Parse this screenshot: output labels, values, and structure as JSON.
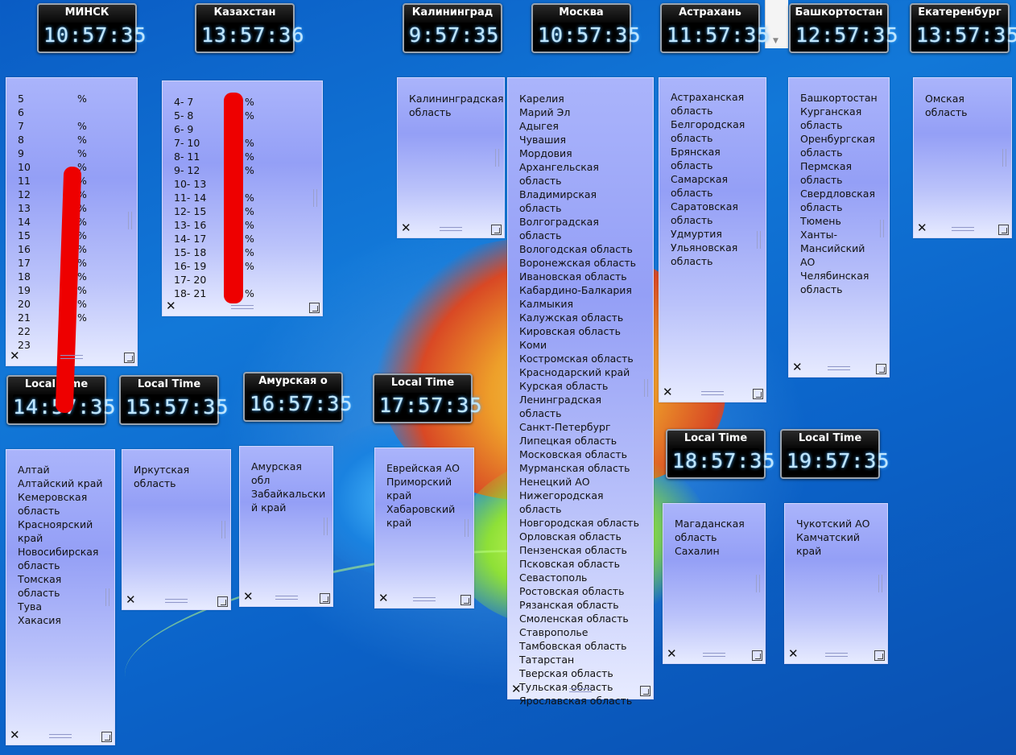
{
  "clocks": [
    {
      "title": "МИНСК",
      "time": "10:57:35"
    },
    {
      "title": "Казахстан",
      "time": "13:57:36"
    },
    {
      "title": "Калининград",
      "time": "9:57:35"
    },
    {
      "title": "Москва",
      "time": "10:57:35"
    },
    {
      "title": "Астрахань",
      "time": "11:57:35"
    },
    {
      "title": "Башкортостан",
      "time": "12:57:35"
    },
    {
      "title": "Екатеренбург",
      "time": "13:57:35"
    },
    {
      "title": "Local Time",
      "time": "14:57:35"
    },
    {
      "title": "Local Time",
      "time": "15:57:35"
    },
    {
      "title": "Амурская о",
      "time": "16:57:35"
    },
    {
      "title": "Local Time",
      "time": "17:57:35"
    },
    {
      "title": "Local Time",
      "time": "18:57:35"
    },
    {
      "title": "Local Time",
      "time": "19:57:35"
    }
  ],
  "notes": {
    "minsk_hours": "5\n6\n7\n8\n9\n10\n11\n12\n13\n14\n15\n16\n17\n18\n19\n20\n21\n22\n23",
    "minsk_pct": "%\n\n%\n%\n%\n%\n%\n%\n%\n%\n%\n%\n%\n%\n%\n%\n%",
    "kz_hours": "4- 7\n5- 8\n6- 9\n7- 10\n8- 11\n9- 12\n10- 13\n11- 14\n12- 15\n13- 16\n14- 17\n15- 18\n16- 19\n17- 20\n18- 21",
    "kz_pct": "%\n%\n\n%\n%\n%\n\n%\n%\n%\n%\n%\n%\n\n%",
    "kaliningrad": "Калининградская\n область",
    "moscow": "Карелия\nМарий Эл\nАдыгея\nЧувашия\nМордовия\nАрхангельская область\nВладимирская область\nВолгоградская область\nВологодская область\nВоронежская область\nИвановская область\nКабардино-Балкария\nКалмыкия\nКалужская область\nКировская область\nКоми\nКостромская область\nКраснодарский край\nКурская область\nЛенинградская область\nСанкт-Петербург\nЛипецкая область\nМосковская область\nМурманская область\nНенецкий АО\nНижегородская область\nНовгородская область\nОрловская область\nПензенская область\nПсковская область\nСевастополь\nРостовская область\nРязанская область\nСмоленская область\nСтаврополье\nТамбовская область\nТатарстан\nТверская область\nТульская область\nЯрославская область",
    "astrakhan": "Астраханская\nобласть\nБелгородская\nобласть\nБрянская\nобласть\nСамарская\nобласть\nСаратовская\nобласть\nУдмуртия\nУльяновская\nобласть",
    "bashkortostan": "Башкортостан\nКурганская\nобласть\nОренбургская\nобласть\nПермская\nобласть\nСвердловская\nобласть\nТюмень\nХанты-\nМансийский\nАО\nЧелябинская\nобласть",
    "omsk": "Омская\nобласть",
    "altai": "Алтай\nАлтайский край\nКемеровская\nобласть\nКрасноярский\nкрай\nНовосибирская\nобласть\nТомская область\nТува\nХакасия",
    "irkutsk": "Иркутская\nобласть",
    "amur": "Амурская обл\nЗабайкальски\nй край",
    "jewish": "Еврейская АО\nПриморский\nкрай\nХабаровский\nкрай",
    "magadan": "Магаданская\nобласть\nСахалин",
    "chukotka": "Чукотский АО\nКамчатский\nкрай"
  },
  "icons": {
    "close": "✕"
  }
}
